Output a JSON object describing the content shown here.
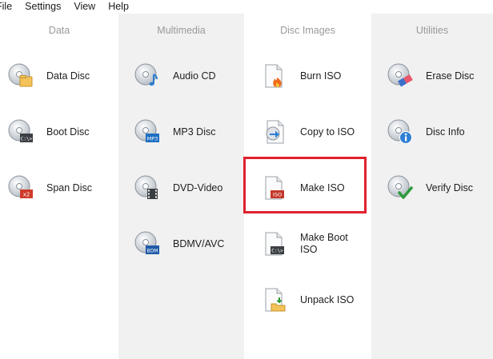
{
  "menu": [
    "File",
    "Settings",
    "View",
    "Help"
  ],
  "columns": {
    "data": {
      "title": "Data",
      "items": [
        "Data Disc",
        "Boot Disc",
        "Span Disc"
      ]
    },
    "multimedia": {
      "title": "Multimedia",
      "items": [
        "Audio CD",
        "MP3 Disc",
        "DVD-Video",
        "BDMV/AVC"
      ]
    },
    "disc_images": {
      "title": "Disc Images",
      "items": [
        "Burn ISO",
        "Copy to ISO",
        "Make ISO",
        "Make Boot ISO",
        "Unpack ISO"
      ]
    },
    "utilities": {
      "title": "Utilities",
      "items": [
        "Erase Disc",
        "Disc Info",
        "Verify Disc"
      ]
    }
  },
  "icon_badges": {
    "boot": "C:\\>",
    "span": "x2",
    "mp3": "MP3",
    "bdmv": "BDM",
    "iso": "ISO"
  },
  "colors": {
    "highlight": "#e0212c",
    "column_gray": "#f1f1f1"
  }
}
